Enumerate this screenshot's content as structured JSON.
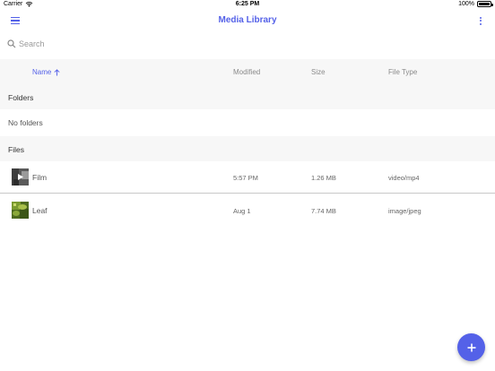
{
  "status_bar": {
    "carrier": "Carrier",
    "time": "6:25 PM",
    "battery": "100%"
  },
  "app_bar": {
    "title": "Media Library",
    "menu_icon": "hamburger-menu-icon",
    "more_icon": "more-vertical-icon"
  },
  "search": {
    "placeholder": "Search",
    "value": ""
  },
  "columns": {
    "name": "Name",
    "modified": "Modified",
    "size": "Size",
    "file_type": "File Type",
    "sort_icon": "arrow-up-icon"
  },
  "folders": {
    "header": "Folders",
    "empty_text": "No folders"
  },
  "files": {
    "header": "Files",
    "items": [
      {
        "name": "Film",
        "modified": "5:57 PM",
        "size": "1.26 MB",
        "type": "video/mp4",
        "thumb_icon": "video-thumbnail"
      },
      {
        "name": "Leaf",
        "modified": "Aug 1",
        "size": "7.74 MB",
        "type": "image/jpeg",
        "thumb_icon": "image-thumbnail"
      }
    ]
  },
  "colors": {
    "accent": "#5461e8",
    "section_bg": "#f7f7f7",
    "divider": "#c9c9c9"
  },
  "fab": {
    "icon": "plus-icon"
  }
}
